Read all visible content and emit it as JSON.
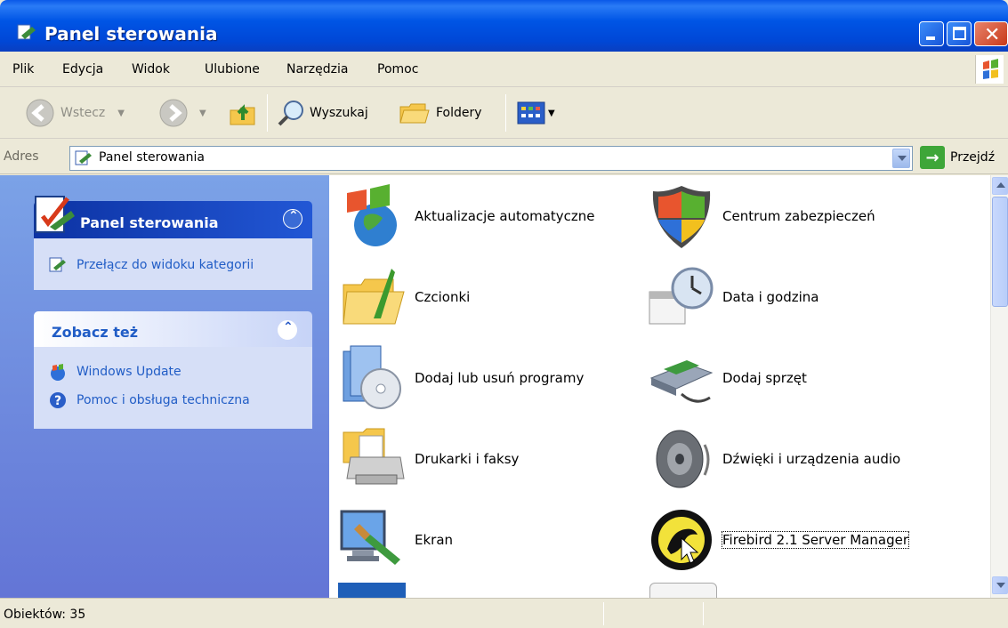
{
  "window": {
    "title": "Panel sterowania"
  },
  "menu": [
    "Plik",
    "Edycja",
    "Widok",
    "Ulubione",
    "Narzędzia",
    "Pomoc"
  ],
  "toolbar": {
    "back": "Wstecz",
    "search": "Wyszukaj",
    "folders": "Foldery"
  },
  "address": {
    "label": "Adres",
    "value": "Panel sterowania",
    "go": "Przejdź"
  },
  "sidebar": {
    "group1": {
      "title": "Panel sterowania",
      "link": "Przełącz do widoku kategorii"
    },
    "group2": {
      "title": "Zobacz też",
      "links": [
        "Windows Update",
        "Pomoc i obsługa techniczna"
      ]
    }
  },
  "items": [
    {
      "label": "Aktualizacje automatyczne",
      "icon": "windows-update-globe-icon"
    },
    {
      "label": "Centrum zabezpieczeń",
      "icon": "security-shield-icon"
    },
    {
      "label": "Czcionki",
      "icon": "fonts-folder-icon"
    },
    {
      "label": "Data i godzina",
      "icon": "clock-calendar-icon"
    },
    {
      "label": "Dodaj lub usuń programy",
      "icon": "add-remove-programs-icon"
    },
    {
      "label": "Dodaj sprzęt",
      "icon": "add-hardware-icon"
    },
    {
      "label": "Drukarki i faksy",
      "icon": "printer-icon"
    },
    {
      "label": "Dźwięki i urządzenia audio",
      "icon": "speaker-icon"
    },
    {
      "label": "Ekran",
      "icon": "display-monitor-icon"
    },
    {
      "label": "Firebird 2.1 Server Manager",
      "icon": "firebird-icon"
    }
  ],
  "status": {
    "objects": "Obiektów: 35"
  },
  "colors": {
    "titlebar": "#0055E5",
    "taskpane": "#7BA2E7",
    "link": "#215DC6"
  }
}
